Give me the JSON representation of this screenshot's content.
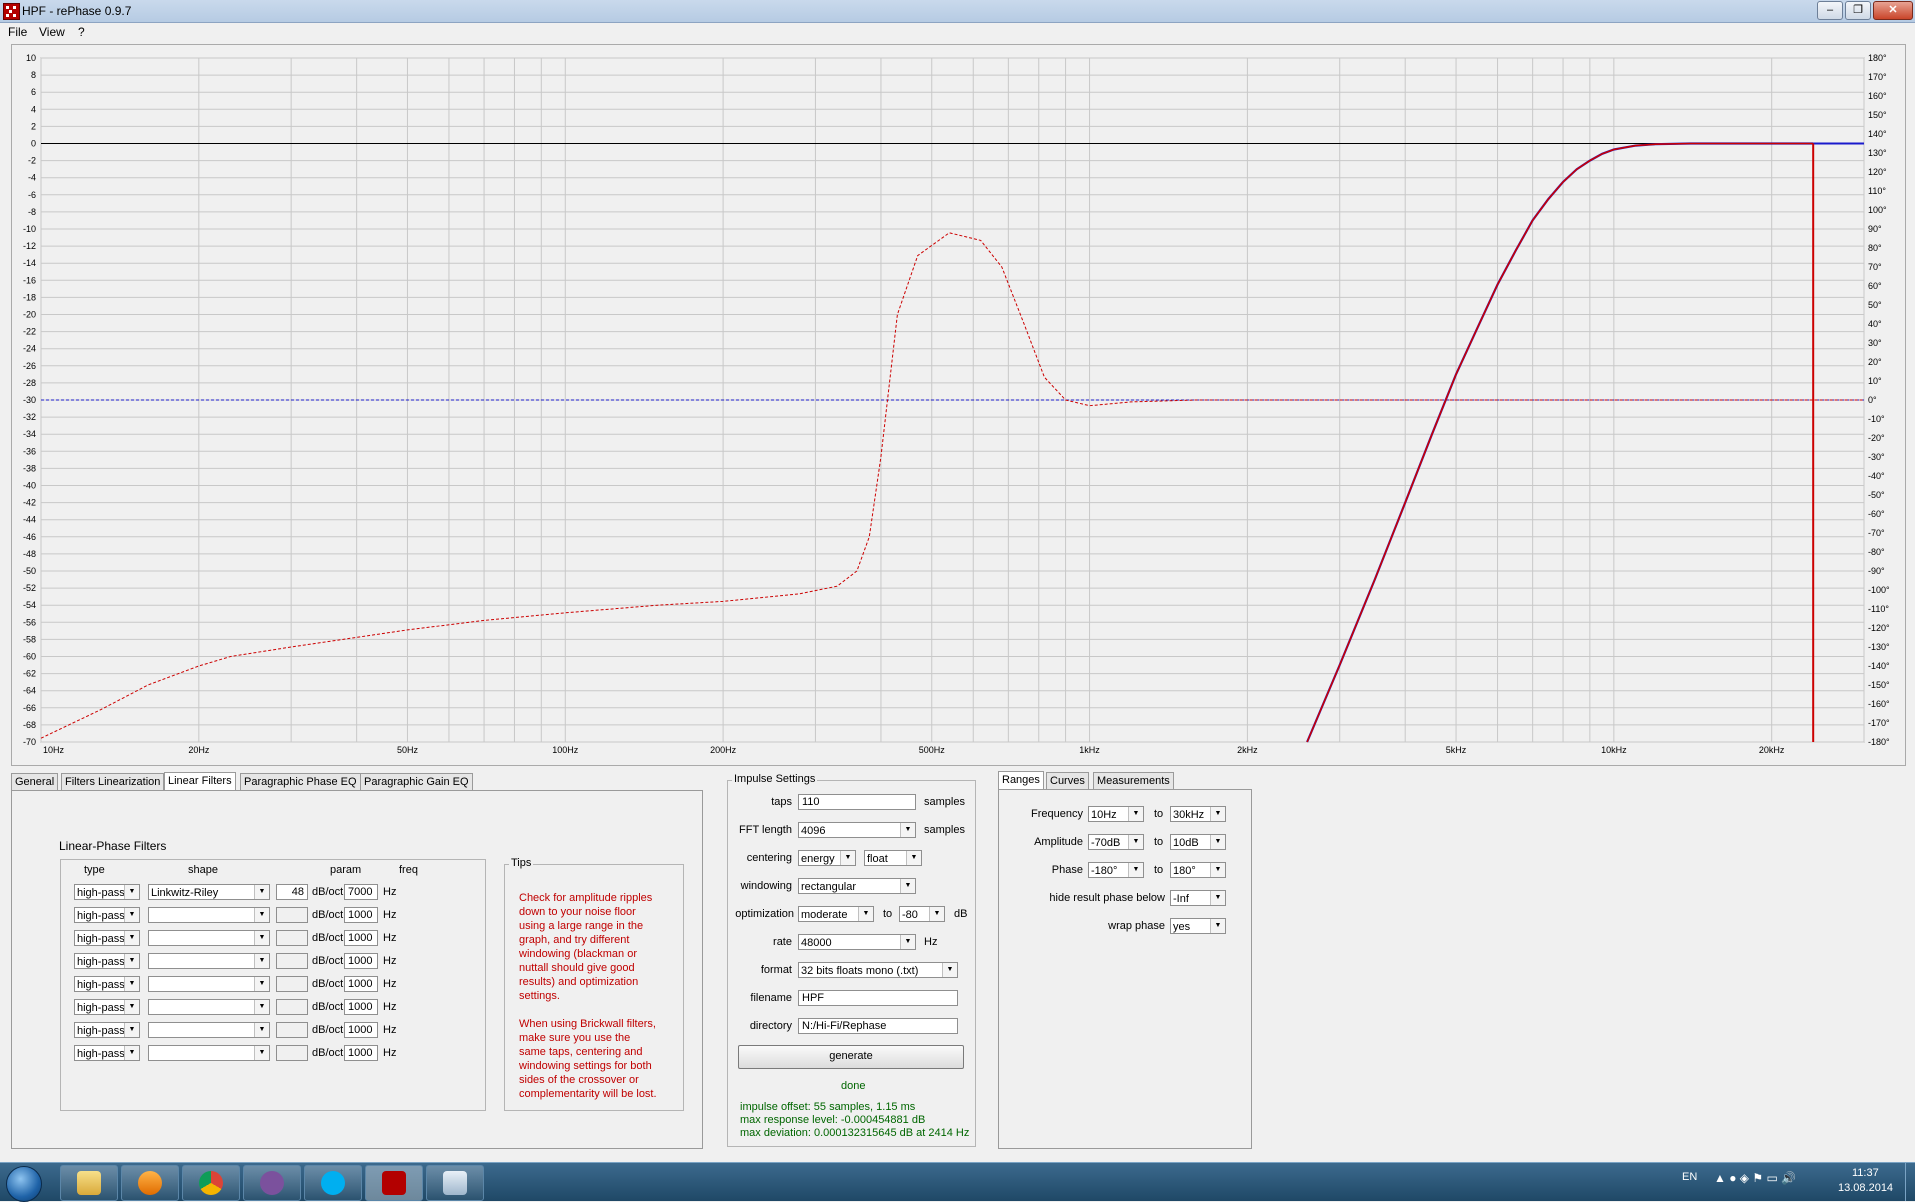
{
  "window": {
    "title": "HPF  -  rePhase 0.9.7"
  },
  "menu": [
    "File",
    "View",
    "?"
  ],
  "graph": {
    "left_axis_ticks": [
      "10",
      "8",
      "6",
      "4",
      "2",
      "0",
      "-2",
      "-4",
      "-6",
      "-8",
      "-10",
      "-12",
      "-14",
      "-16",
      "-18",
      "-20",
      "-22",
      "-24",
      "-26",
      "-28",
      "-30",
      "-32",
      "-34",
      "-36",
      "-38",
      "-40",
      "-42",
      "-44",
      "-46",
      "-48",
      "-50",
      "-52",
      "-54",
      "-56",
      "-58",
      "-60",
      "-62",
      "-64",
      "-66",
      "-68",
      "-70"
    ],
    "right_axis_ticks": [
      "180°",
      "170°",
      "160°",
      "150°",
      "140°",
      "130°",
      "120°",
      "110°",
      "100°",
      "90°",
      "80°",
      "70°",
      "60°",
      "50°",
      "40°",
      "30°",
      "20°",
      "10°",
      "0°",
      "-10°",
      "-20°",
      "-30°",
      "-40°",
      "-50°",
      "-60°",
      "-70°",
      "-80°",
      "-90°",
      "-100°",
      "-110°",
      "-120°",
      "-130°",
      "-140°",
      "-150°",
      "-160°",
      "-170°",
      "-180°"
    ],
    "x_ticks": [
      {
        "label": "10Hz",
        "f": 10
      },
      {
        "label": "20Hz",
        "f": 20
      },
      {
        "label": "50Hz",
        "f": 50
      },
      {
        "label": "100Hz",
        "f": 100
      },
      {
        "label": "200Hz",
        "f": 200
      },
      {
        "label": "500Hz",
        "f": 500
      },
      {
        "label": "1kHz",
        "f": 1000
      },
      {
        "label": "2kHz",
        "f": 2000
      },
      {
        "label": "5kHz",
        "f": 5000
      },
      {
        "label": "10kHz",
        "f": 10000
      },
      {
        "label": "20kHz",
        "f": 20000
      }
    ],
    "x_range_hz": [
      10,
      30000
    ],
    "db_range": [
      -70,
      10
    ],
    "phase_range_deg": [
      -180,
      180
    ],
    "colors": {
      "amplitude": "#cc0000",
      "phase_ref": "#1a1acc",
      "zero_line": "#000000",
      "grid": "#c8c8c8",
      "cursor": "#cc0000"
    },
    "cursor_hz": 24000,
    "amplitude_curve": [
      [
        2600,
        -70
      ],
      [
        3000,
        -61
      ],
      [
        3500,
        -51
      ],
      [
        4000,
        -42
      ],
      [
        4500,
        -34
      ],
      [
        5000,
        -27
      ],
      [
        5500,
        -21.5
      ],
      [
        6000,
        -16.5
      ],
      [
        6500,
        -12.5
      ],
      [
        7000,
        -9
      ],
      [
        7500,
        -6.5
      ],
      [
        8000,
        -4.5
      ],
      [
        8500,
        -3
      ],
      [
        9000,
        -2
      ],
      [
        9500,
        -1.2
      ],
      [
        10000,
        -0.7
      ],
      [
        11000,
        -0.25
      ],
      [
        12000,
        -0.08
      ],
      [
        14000,
        0
      ],
      [
        24000,
        0
      ]
    ],
    "phase_curve": [
      [
        10,
        -178
      ],
      [
        13,
        -163
      ],
      [
        16,
        -150
      ],
      [
        20,
        -140
      ],
      [
        23,
        -135
      ],
      [
        30,
        -130
      ],
      [
        50,
        -121
      ],
      [
        70,
        -116
      ],
      [
        100,
        -112
      ],
      [
        150,
        -108
      ],
      [
        200,
        -106
      ],
      [
        280,
        -102
      ],
      [
        330,
        -98
      ],
      [
        360,
        -90
      ],
      [
        380,
        -72
      ],
      [
        400,
        -30
      ],
      [
        430,
        45
      ],
      [
        470,
        76
      ],
      [
        540,
        88
      ],
      [
        620,
        84
      ],
      [
        680,
        70
      ],
      [
        750,
        40
      ],
      [
        820,
        12
      ],
      [
        900,
        0
      ],
      [
        1000,
        -3
      ],
      [
        1200,
        -1
      ],
      [
        1600,
        0
      ],
      [
        30000,
        0
      ]
    ]
  },
  "tabs_left": [
    "General",
    "Filters Linearization",
    "Linear Filters",
    "Paragraphic Phase EQ",
    "Paragraphic Gain EQ"
  ],
  "linear_filters": {
    "title": "Linear-Phase Filters",
    "headers": {
      "type": "type",
      "shape": "shape",
      "param": "param",
      "freq": "freq"
    },
    "rows": [
      {
        "type": "high-pass",
        "shape": "Linkwitz-Riley",
        "param": "48",
        "unit": "dB/oct",
        "freq": "7000",
        "hz": "Hz"
      },
      {
        "type": "high-pass",
        "shape": "",
        "param": "",
        "unit": "dB/oct",
        "freq": "1000",
        "hz": "Hz"
      },
      {
        "type": "high-pass",
        "shape": "",
        "param": "",
        "unit": "dB/oct",
        "freq": "1000",
        "hz": "Hz"
      },
      {
        "type": "high-pass",
        "shape": "",
        "param": "",
        "unit": "dB/oct",
        "freq": "1000",
        "hz": "Hz"
      },
      {
        "type": "high-pass",
        "shape": "",
        "param": "",
        "unit": "dB/oct",
        "freq": "1000",
        "hz": "Hz"
      },
      {
        "type": "high-pass",
        "shape": "",
        "param": "",
        "unit": "dB/oct",
        "freq": "1000",
        "hz": "Hz"
      },
      {
        "type": "high-pass",
        "shape": "",
        "param": "",
        "unit": "dB/oct",
        "freq": "1000",
        "hz": "Hz"
      },
      {
        "type": "high-pass",
        "shape": "",
        "param": "",
        "unit": "dB/oct",
        "freq": "1000",
        "hz": "Hz"
      }
    ]
  },
  "tips": {
    "title": "Tips",
    "text1": [
      "Check for amplitude ripples",
      "down to your noise floor",
      "using a large range in the",
      "graph, and try different",
      "windowing (blackman or",
      "nuttall should give good",
      "results) and optimization",
      "settings."
    ],
    "text2": [
      "When using Brickwall filters,",
      "make sure you use the",
      "same taps, centering and",
      "windowing settings for both",
      "sides of the crossover or",
      "complementarity will be lost."
    ]
  },
  "impulse": {
    "title": "Impulse Settings",
    "taps_label": "taps",
    "taps": "110",
    "samples": "samples",
    "fft_label": "FFT length",
    "fft": "4096",
    "centering_label": "centering",
    "centering": "energy",
    "centering2": "float",
    "windowing_label": "windowing",
    "windowing": "rectangular",
    "optimization_label": "optimization",
    "optimization": "moderate",
    "to": "to",
    "opt_db": "-80",
    "db": "dB",
    "rate_label": "rate",
    "rate": "48000",
    "hz": "Hz",
    "format_label": "format",
    "format": "32 bits floats mono (.txt)",
    "filename_label": "filename",
    "filename": "HPF",
    "directory_label": "directory",
    "directory": "N:/Hi-Fi/Rephase",
    "generate": "generate",
    "status": "done",
    "info1": "impulse offset: 55 samples, 1.15 ms",
    "info2": "max response level: -0.000454881 dB",
    "info3": "max deviation: 0.000132315645 dB at 2414 Hz"
  },
  "tabs_right": [
    "Ranges",
    "Curves",
    "Measurements"
  ],
  "ranges": {
    "frequency_label": "Frequency",
    "freq_from": "10Hz",
    "freq_to": "30kHz",
    "amplitude_label": "Amplitude",
    "amp_from": "-70dB",
    "amp_to": "10dB",
    "phase_label": "Phase",
    "phase_from": "-180°",
    "phase_to": "180°",
    "to": "to",
    "hide_label": "hide result phase below",
    "hide": "-Inf",
    "wrap_label": "wrap phase",
    "wrap": "yes"
  },
  "taskbar": {
    "lang": "EN",
    "time": "11:37",
    "date": "13.08.2014"
  }
}
